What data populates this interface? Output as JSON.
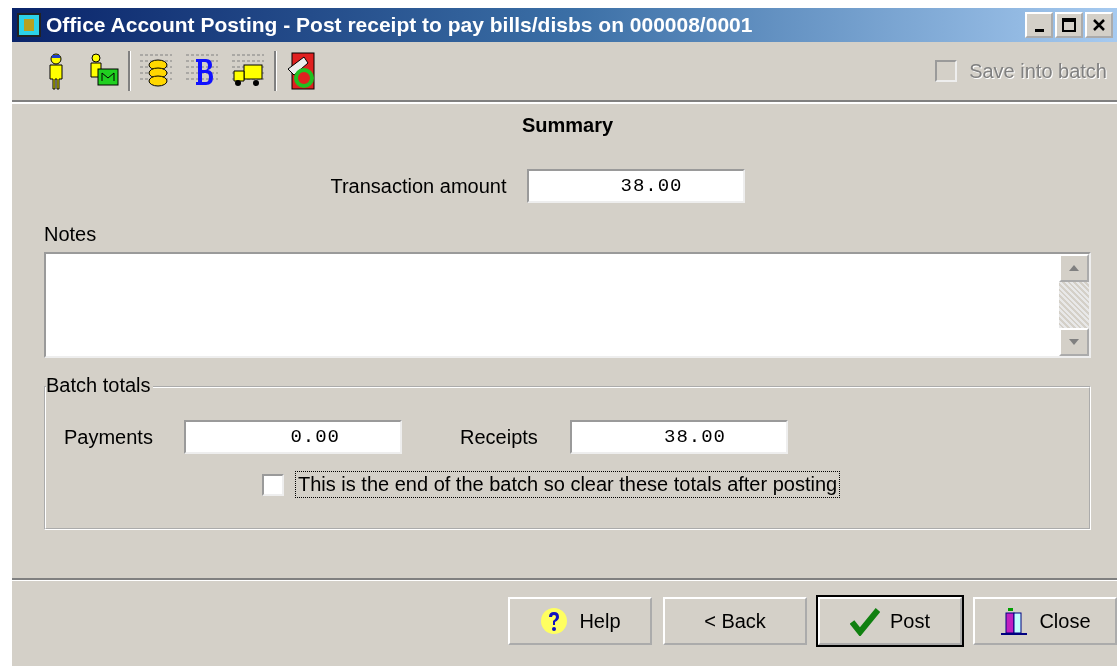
{
  "window": {
    "title": "Office Account Posting - Post receipt to pay bills/disbs on 000008/0001"
  },
  "toolbar": {
    "groups": [
      [
        {
          "kind": "person"
        },
        {
          "kind": "person-folder"
        }
      ],
      [
        {
          "kind": "coins-ledger"
        },
        {
          "kind": "letter-ledger"
        },
        {
          "kind": "truck-ledger"
        }
      ],
      [
        {
          "kind": "document-return"
        }
      ]
    ]
  },
  "save_into_batch": {
    "label": "Save into batch",
    "checked": false,
    "disabled": true
  },
  "summary": {
    "heading": "Summary",
    "transaction_amount": {
      "label": "Transaction amount",
      "value": "38.00"
    }
  },
  "notes": {
    "label": "Notes"
  },
  "batch_totals": {
    "legend": "Batch totals",
    "payments": {
      "label": "Payments",
      "value": "0.00"
    },
    "receipts": {
      "label": "Receipts",
      "value": "38.00"
    },
    "end_of_batch": {
      "label": "This is the end of the batch so clear these totals after posting",
      "checked": false,
      "focused": true
    }
  },
  "buttons": [
    {
      "label": "Help",
      "kind": "help",
      "default": false
    },
    {
      "label": "< Back",
      "kind": "back",
      "default": false
    },
    {
      "label": "Post",
      "kind": "post",
      "default": true
    },
    {
      "label": "Close",
      "kind": "close",
      "default": false
    }
  ]
}
